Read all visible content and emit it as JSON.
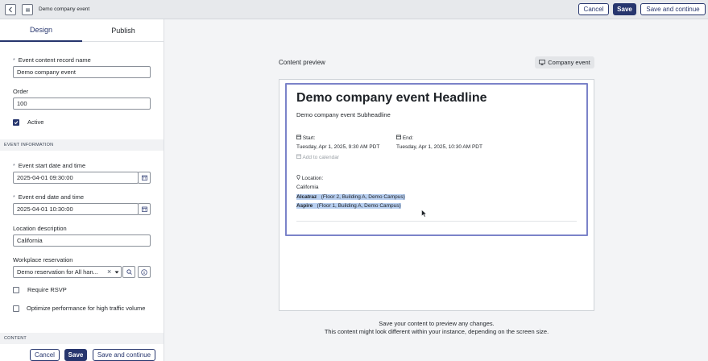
{
  "header": {
    "title": "Demo company event",
    "back_icon": "chevron-left-icon",
    "menu_icon": "form-icon",
    "cancel_label": "Cancel",
    "save_label": "Save",
    "save_continue_label": "Save and continue"
  },
  "tabs": [
    {
      "label": "Design",
      "active": true
    },
    {
      "label": "Publish",
      "active": false
    }
  ],
  "form": {
    "record_name_label": "Event content record name",
    "record_name_value": "Demo company event",
    "order_label": "Order",
    "order_value": "100",
    "active_label": "Active",
    "active_checked": true,
    "section_event_info": "EVENT INFORMATION",
    "start_label": "Event start date and time",
    "start_value": "2025-04-01 09:30:00",
    "end_label": "Event end date and time",
    "end_value": "2025-04-01 10:30:00",
    "location_label": "Location description",
    "location_value": "California",
    "workplace_label": "Workplace reservation",
    "workplace_value": "Demo reservation for All han...",
    "rsvp_label": "Require RSVP",
    "rsvp_checked": false,
    "optimize_label": "Optimize performance for high traffic volume",
    "optimize_checked": false,
    "section_content": "CONTENT",
    "required_mark": "*"
  },
  "footer": {
    "cancel_label": "Cancel",
    "save_label": "Save",
    "save_continue_label": "Save and continue"
  },
  "preview": {
    "label": "Content preview",
    "chip_label": "Company event",
    "headline": "Demo company event Headline",
    "subheadline": "Demo company event Subheadline",
    "start_label": "Start:",
    "start_value": "Tuesday, Apr 1, 2025, 9:30 AM PDT",
    "end_label": "End:",
    "end_value": "Tuesday, Apr 1, 2025, 10:30 AM PDT",
    "add_to_calendar": "Add to calendar",
    "location_label": "Location:",
    "location_value": "California",
    "rooms": [
      {
        "name": "Alcatraz",
        "detail": "(Floor 2, Building A, Demo Campus)"
      },
      {
        "name": "Aspire",
        "detail": "(Floor 1, Building A, Demo Campus)"
      }
    ],
    "note_line1": "Save your content to preview any changes.",
    "note_line2": "This content might look different within your instance, depending on the screen size."
  },
  "colors": {
    "brand": "#27366e",
    "highlight": "#b8cff0",
    "card_border": "#7b83c9"
  }
}
